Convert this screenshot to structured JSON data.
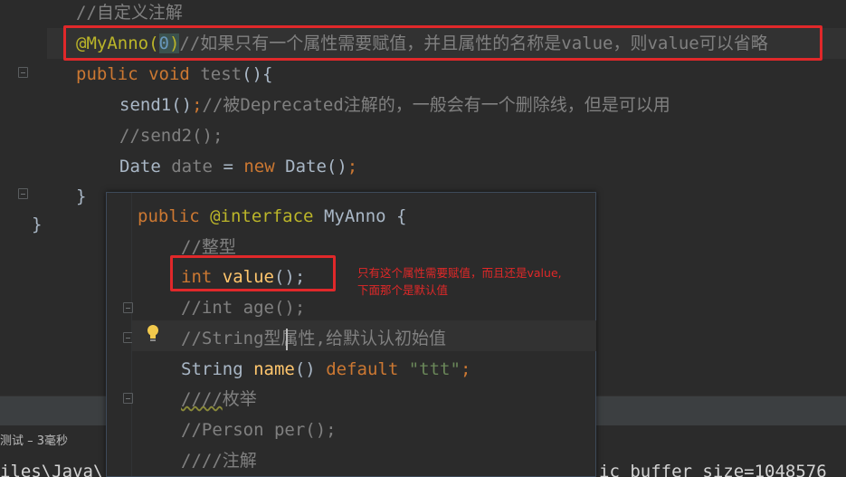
{
  "editor": {
    "lines": [
      {
        "id": "comment-custom-annotation",
        "text": "//自定义注解"
      },
      {
        "id": "annotation-usage"
      },
      {
        "id": "method-decl"
      },
      {
        "id": "send1-line"
      },
      {
        "id": "send2-line",
        "text": "//send2();"
      },
      {
        "id": "date-line"
      },
      {
        "id": "close-brace-1",
        "text": "}"
      },
      {
        "id": "close-brace-2",
        "text": "}"
      }
    ],
    "annotation_line": {
      "ann": "@MyAnno(",
      "num": "0",
      "close": ")",
      "comment": "//如果只有一个属性需要赋值，并且属性的名称是value，则value可以省略"
    },
    "method_line": {
      "kw1": "public",
      "kw2": "void",
      "name": "test",
      "rest": "(){"
    },
    "send1_line": {
      "call": "send1()",
      "semi": ";",
      "comment": "//被Deprecated注解的，一般会有一个删除线，但是可以用"
    },
    "date_line": {
      "type": "Date",
      "var": "date",
      "eq": "=",
      "kw": "new",
      "call": "Date()",
      "semi": ";"
    }
  },
  "popup": {
    "header": {
      "kw": "public",
      "ann": "@interface",
      "name": "MyAnno",
      "brace": "{"
    },
    "comment_int": "//整型",
    "int_line": {
      "type": "int",
      "name": "value",
      "rest": "();"
    },
    "age_line": "//int age();",
    "string_comment": "//String型属性,给默认认初始值",
    "string_line": {
      "type": "String",
      "name": "name",
      "rest": "()",
      "kw": "default",
      "str": "\"ttt\"",
      "semi": ";"
    },
    "enum_comment_prefix": "////",
    "enum_comment_text": "枚举",
    "person_line": "//Person per();",
    "annotation_comment": "////注解"
  },
  "note": {
    "line1": "只有这个属性需要赋值，而且还是value,",
    "line2": "下面那个是默认值"
  },
  "bottom": {
    "run_label": "测试 – 3毫秒",
    "console_left": "iles\\Java\\",
    "console_right": "ic buffer size=1048576"
  },
  "colors": {
    "highlight_box": "#e0282a",
    "background": "#2b2b2b",
    "keyword": "#cc7832",
    "annotation": "#bbb529"
  }
}
